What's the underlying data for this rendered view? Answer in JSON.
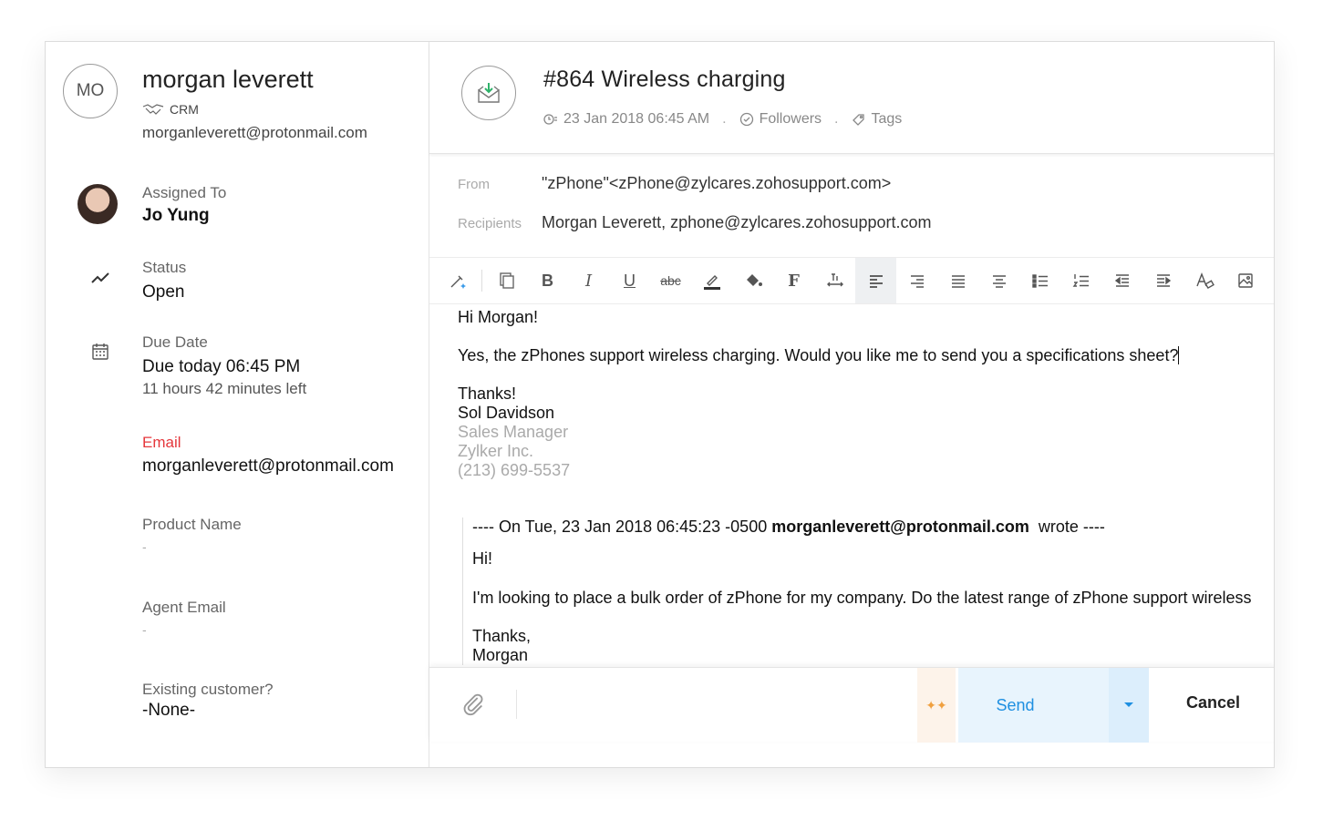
{
  "contact": {
    "initials": "MO",
    "name": "morgan leverett",
    "source": "CRM",
    "email": "morganleverett@protonmail.com"
  },
  "fields": {
    "assigned_label": "Assigned To",
    "assigned_value": "Jo Yung",
    "status_label": "Status",
    "status_value": "Open",
    "due_label": "Due Date",
    "due_value": "Due today 06:45 PM",
    "due_sub": "11 hours 42 minutes left",
    "email_label": "Email",
    "email_value": "morganleverett@protonmail.com",
    "product_label": "Product Name",
    "product_value": "-",
    "agent_email_label": "Agent Email",
    "agent_email_value": "-",
    "existing_label": "Existing customer?",
    "existing_value": "-None-"
  },
  "ticket": {
    "title": "#864  Wireless charging",
    "datetime": "23 Jan 2018 06:45 AM",
    "followers": "Followers",
    "tags": "Tags"
  },
  "compose": {
    "from_label": "From",
    "from_value": "\"zPhone\"<zPhone@zylcares.zohosupport.com>",
    "recipients_label": "Recipients",
    "recipients_value": "Morgan Leverett, zphone@zylcares.zohosupport.com"
  },
  "body": {
    "greeting": "Hi Morgan!",
    "line1": "Yes, the zPhones support wireless charging. Would you like me to send you a specifications sheet?",
    "thanks": "Thanks!",
    "sig_name": "Sol Davidson",
    "sig_title": "Sales Manager",
    "sig_company": "Zylker Inc.",
    "sig_phone": "(213) 699-5537"
  },
  "quote": {
    "header_prefix": "---- On Tue, 23 Jan 2018 06:45:23 -0500",
    "header_email": "morganleverett@protonmail.com",
    "header_suffix": "wrote ----",
    "hi": "Hi!",
    "line1": "I'm looking to place a bulk order of zPhone for my company. Do the latest range of zPhone support wireless",
    "thanks": "Thanks,",
    "name": "Morgan"
  },
  "footer": {
    "send_label": "Send",
    "cancel_label": "Cancel"
  }
}
